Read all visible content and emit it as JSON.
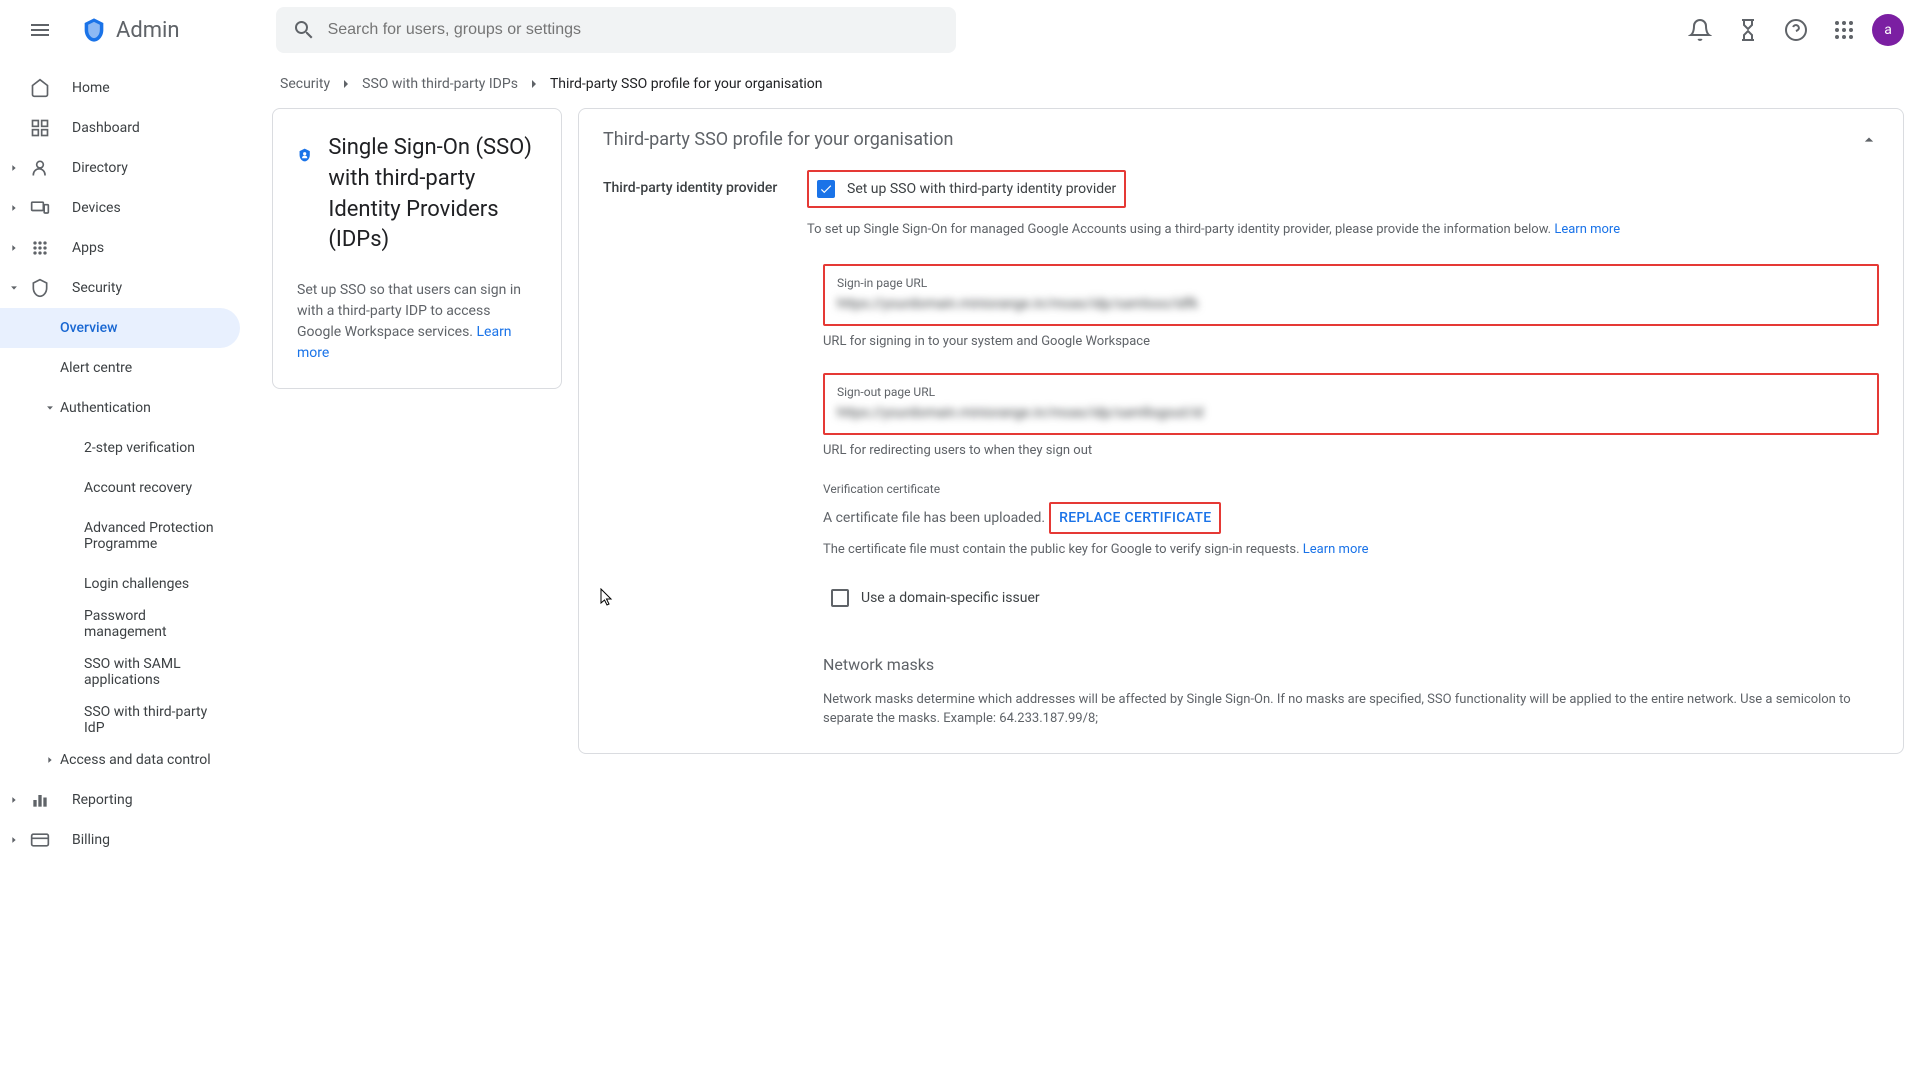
{
  "header": {
    "title": "Admin",
    "search_placeholder": "Search for users, groups or settings",
    "avatar_initial": "a"
  },
  "sidebar": {
    "items": [
      {
        "label": "Home",
        "icon": "home"
      },
      {
        "label": "Dashboard",
        "icon": "dashboard"
      },
      {
        "label": "Directory",
        "icon": "person",
        "expandable": true
      },
      {
        "label": "Devices",
        "icon": "devices",
        "expandable": true
      },
      {
        "label": "Apps",
        "icon": "apps",
        "expandable": true
      },
      {
        "label": "Security",
        "icon": "shield",
        "expanded": true,
        "children": [
          {
            "label": "Overview",
            "active": true
          },
          {
            "label": "Alert centre"
          },
          {
            "label": "Authentication",
            "expanded": true,
            "children": [
              {
                "label": "2-step verification"
              },
              {
                "label": "Account recovery"
              },
              {
                "label": "Advanced Protection Programme"
              },
              {
                "label": "Login challenges"
              },
              {
                "label": "Password management"
              },
              {
                "label": "SSO with SAML applications"
              },
              {
                "label": "SSO with third-party IdP"
              }
            ]
          },
          {
            "label": "Access and data control",
            "expandable": true
          }
        ]
      },
      {
        "label": "Reporting",
        "icon": "chart",
        "expandable": true
      },
      {
        "label": "Billing",
        "icon": "card",
        "expandable": true
      }
    ]
  },
  "breadcrumbs": [
    {
      "label": "Security"
    },
    {
      "label": "SSO with third-party IDPs"
    },
    {
      "label": "Third-party SSO profile for your organisation",
      "current": true
    }
  ],
  "info_card": {
    "title": "Single Sign-On (SSO) with third-party Identity Providers (IDPs)",
    "description": "Set up SSO so that users can sign in with a third-party IDP to access Google Workspace services. ",
    "learn_more": "Learn more"
  },
  "panel": {
    "title": "Third-party SSO profile for your organisation",
    "section_label": "Third-party identity provider",
    "setup_checkbox": {
      "checked": true,
      "label": "Set up SSO with third-party identity provider"
    },
    "setup_helper": "To set up Single Sign-On for managed Google Accounts using a third-party identity provider, please provide the information below. ",
    "learn_more": "Learn more",
    "signin_url": {
      "label": "Sign-in page URL",
      "value": "https://yourdomain.miniorange.in/moas/idp/samlsso/idfk",
      "helper": "URL for signing in to your system and Google Workspace"
    },
    "signout_url": {
      "label": "Sign-out page URL",
      "value": "https://yourdomain.miniorange.in/moas/idp/samllogout/id",
      "helper": "URL for redirecting users to when they sign out"
    },
    "certificate": {
      "label": "Verification certificate",
      "status": "A certificate file has been uploaded.",
      "button": "REPLACE CERTIFICATE",
      "helper": "The certificate file must contain the public key for Google to verify sign-in requests. "
    },
    "domain_issuer": {
      "checked": false,
      "label": "Use a domain-specific issuer"
    },
    "network_masks": {
      "title": "Network masks",
      "description": "Network masks determine which addresses will be affected by Single Sign-On. If no masks are specified, SSO functionality will be applied to the entire network. Use a semicolon to separate the masks. Example: 64.233.187.99/8;"
    }
  }
}
